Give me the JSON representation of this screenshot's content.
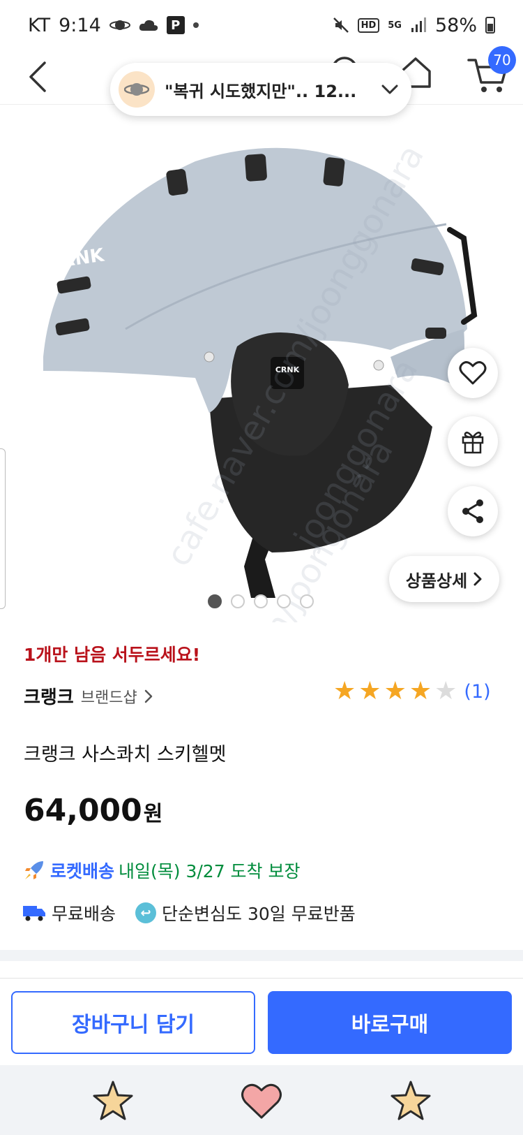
{
  "status_bar": {
    "carrier": "KT",
    "time": "9:14",
    "battery": "58%",
    "network": "5G",
    "hd": "HD",
    "app_badge": "P"
  },
  "header": {
    "cart_count": "70",
    "icons": [
      "back-arrow-icon",
      "search-icon",
      "home-icon",
      "cart-icon"
    ]
  },
  "chat_pill": {
    "text": "\"복귀 시도했지만\".. 12..."
  },
  "product_image": {
    "watermarks": [
      "cafe.naver.com/joonggonara",
      "joonggonara",
      "m/joongonara"
    ],
    "helmet_logo": "CRNK"
  },
  "floating_actions": {
    "detail_label": "상품상세"
  },
  "carousel": {
    "page_count": 5,
    "active_index": 0
  },
  "product": {
    "stock_warning": "1개만 남음 서두르세요!",
    "brand": "크랭크",
    "brand_shop": "브랜드샵",
    "rating_stars": 4,
    "rating_max": 5,
    "rating_count": "(1)",
    "title": "크랭크 사스콰치 스키헬멧",
    "price": "64,000",
    "price_unit": "원"
  },
  "delivery": {
    "rocket_label": "로켓배송",
    "rocket_date": "내일(목) 3/27 도착 보장",
    "free_shipping": "무료배송",
    "return_policy": "단순변심도 30일 무료반품"
  },
  "actions": {
    "add_to_cart": "장바구니 담기",
    "buy_now": "바로구매"
  },
  "colors": {
    "accent": "#346aff",
    "warning": "#b9121b",
    "rocket_date": "#008c3c",
    "star": "#f5a623",
    "helmet": "#bfc9d4"
  }
}
